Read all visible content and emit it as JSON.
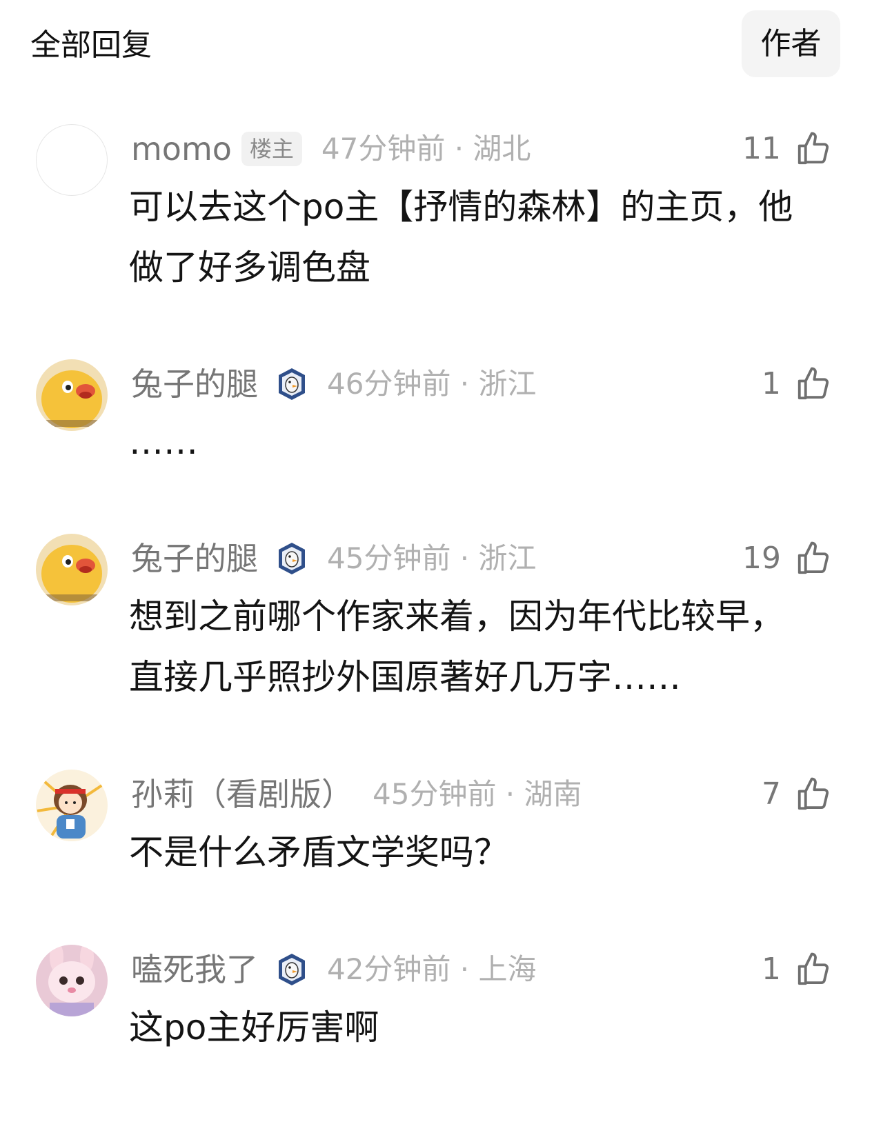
{
  "header": {
    "title": "全部回复",
    "author_button": "作者"
  },
  "comments": [
    {
      "user": "momo",
      "badge": "楼主",
      "time_location": "47分钟前 · 湖北",
      "likes": "11",
      "text": "可以去这个po主【抒情的森林】的主页，他做了好多调色盘"
    },
    {
      "user": "兔子的腿",
      "time_location": "46分钟前 · 浙江",
      "likes": "1",
      "text": "……"
    },
    {
      "user": "兔子的腿",
      "time_location": "45分钟前 · 浙江",
      "likes": "19",
      "text": "想到之前哪个作家来着，因为年代比较早，直接几乎照抄外国原著好几万字……"
    },
    {
      "user": "孙莉（看剧版）",
      "time_location": "45分钟前 · 湖南",
      "likes": "7",
      "text": "不是什么矛盾文学奖吗？"
    },
    {
      "user": "嗑死我了",
      "time_location": "42分钟前 · 上海",
      "likes": "1",
      "text": "这po主好厉害啊"
    }
  ]
}
